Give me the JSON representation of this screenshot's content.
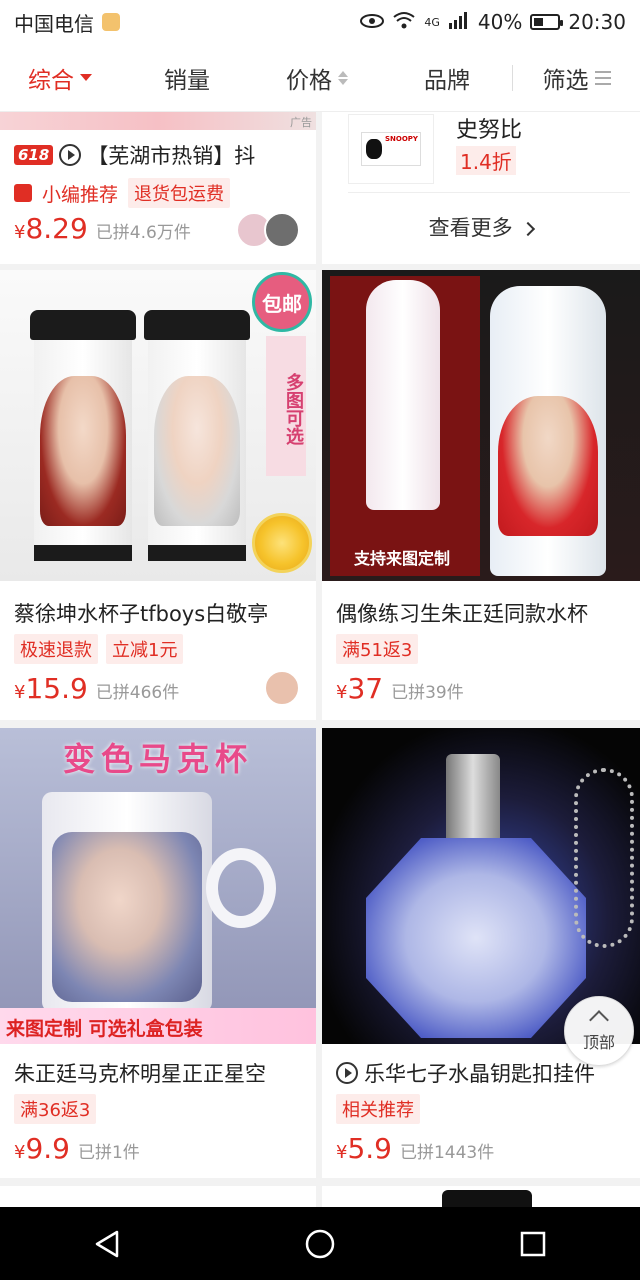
{
  "status_bar": {
    "carrier": "中国电信",
    "network": "4G",
    "battery": "40%",
    "battery_level": 0.4,
    "time": "20:30"
  },
  "sort_bar": {
    "tabs": [
      {
        "label": "综合",
        "active": true
      },
      {
        "label": "销量"
      },
      {
        "label": "价格"
      },
      {
        "label": "品牌"
      },
      {
        "label": "筛选"
      }
    ]
  },
  "products": [
    {
      "badge": "618",
      "title": "【芜湖市热销】抖",
      "tags": [
        "小编推荐",
        "退货包运费"
      ],
      "price": "8.29",
      "sold": "已拼4.6万件",
      "ad_label": "广告"
    },
    {
      "brand_name": "史努比",
      "brand_discount": "1.4折",
      "see_more": "查看更多"
    },
    {
      "title": "蔡徐坤水杯子tfboys白敬亭",
      "tags": [
        "极速退款",
        "立减1元"
      ],
      "price": "15.9",
      "sold": "已拼466件",
      "image_badge": "包邮",
      "image_side_text": "多图可选"
    },
    {
      "title": "偶像练习生朱正廷同款水杯",
      "tags": [
        "满51返3"
      ],
      "price": "37",
      "sold": "已拼39件",
      "image_caption": "支持来图定制"
    },
    {
      "title": "朱正廷马克杯明星正正星空",
      "tags": [
        "满36返3"
      ],
      "price": "9.9",
      "sold": "已拼1件",
      "image_title": "变色马克杯",
      "image_banner": "来图定制 可选礼盒包装"
    },
    {
      "title": "乐华七子水晶钥匙扣挂件",
      "tags": [
        "相关推荐"
      ],
      "price": "5.9",
      "sold": "已拼1443件"
    }
  ],
  "currency": "¥",
  "back_to_top": "顶部",
  "colors": {
    "accent": "#e02e24",
    "tag_bg": "#fdecea"
  }
}
